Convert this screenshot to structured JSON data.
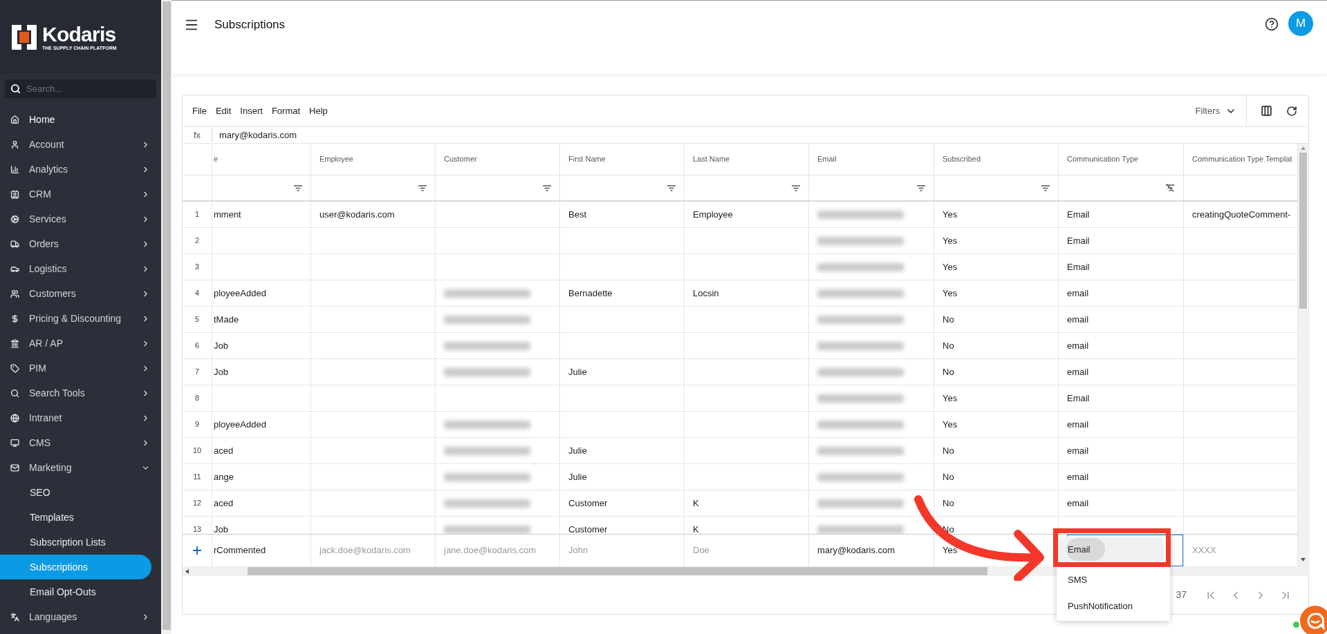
{
  "sidebar": {
    "logo": {
      "name": "Kodaris",
      "tagline": "THE SUPPLY CHAIN PLATFORM"
    },
    "search_placeholder": "Search...",
    "items": [
      {
        "label": "Home",
        "expandable": false
      },
      {
        "label": "Account",
        "expandable": true,
        "expanded": false
      },
      {
        "label": "Analytics",
        "expandable": true,
        "expanded": false
      },
      {
        "label": "CRM",
        "expandable": true,
        "expanded": false
      },
      {
        "label": "Services",
        "expandable": true,
        "expanded": false
      },
      {
        "label": "Orders",
        "expandable": true,
        "expanded": false
      },
      {
        "label": "Logistics",
        "expandable": true,
        "expanded": false
      },
      {
        "label": "Customers",
        "expandable": true,
        "expanded": false
      },
      {
        "label": "Pricing & Discounting",
        "expandable": true,
        "expanded": false
      },
      {
        "label": "AR / AP",
        "expandable": true,
        "expanded": false
      },
      {
        "label": "PIM",
        "expandable": true,
        "expanded": false
      },
      {
        "label": "Search Tools",
        "expandable": true,
        "expanded": false
      },
      {
        "label": "Intranet",
        "expandable": true,
        "expanded": false
      },
      {
        "label": "CMS",
        "expandable": true,
        "expanded": false
      },
      {
        "label": "Marketing",
        "expandable": true,
        "expanded": true,
        "children": [
          {
            "label": "SEO",
            "selected": false
          },
          {
            "label": "Templates",
            "selected": false
          },
          {
            "label": "Subscription Lists",
            "selected": false
          },
          {
            "label": "Subscriptions",
            "selected": true
          },
          {
            "label": "Email Opt-Outs",
            "selected": false
          }
        ]
      },
      {
        "label": "Languages",
        "expandable": true,
        "expanded": false
      }
    ]
  },
  "header": {
    "title": "Subscriptions",
    "avatar": "M"
  },
  "toolbar": {
    "menus": [
      "File",
      "Edit",
      "Insert",
      "Format",
      "Help"
    ],
    "filters": "Filters"
  },
  "formula_bar": {
    "label": "fx",
    "value": "mary@kodaris.com"
  },
  "table": {
    "columns": [
      {
        "label": "e",
        "filterable": true,
        "filter_active": false
      },
      {
        "label": "Employee",
        "filterable": true,
        "filter_active": false
      },
      {
        "label": "Customer",
        "filterable": true,
        "filter_active": false
      },
      {
        "label": "First Name",
        "filterable": true,
        "filter_active": false
      },
      {
        "label": "Last Name",
        "filterable": true,
        "filter_active": false
      },
      {
        "label": "Email",
        "filterable": true,
        "filter_active": false
      },
      {
        "label": "Subscribed",
        "filterable": true,
        "filter_active": false
      },
      {
        "label": "Communication Type",
        "filterable": true,
        "filter_active": true
      },
      {
        "label": "Communication Type Templat",
        "filterable": false
      }
    ],
    "rows": [
      {
        "number": "1",
        "cells": [
          "mment",
          "user@kodaris.com",
          null,
          "Best",
          "Employee",
          {
            "redacted": true
          },
          "Yes",
          "Email",
          "creatingQuoteComment-"
        ]
      },
      {
        "number": "2",
        "cells": [
          null,
          null,
          null,
          null,
          null,
          {
            "redacted": true
          },
          "Yes",
          "Email",
          null
        ]
      },
      {
        "number": "3",
        "cells": [
          null,
          null,
          null,
          null,
          null,
          {
            "redacted": true
          },
          "Yes",
          "Email",
          null
        ]
      },
      {
        "number": "4",
        "cells": [
          "ployeeAdded",
          null,
          {
            "redacted": true
          },
          "Bernadette",
          "Locsin",
          {
            "redacted": true
          },
          "Yes",
          "email",
          null
        ]
      },
      {
        "number": "5",
        "cells": [
          "tMade",
          null,
          {
            "redacted": true
          },
          null,
          null,
          {
            "redacted": true
          },
          "No",
          "email",
          null
        ]
      },
      {
        "number": "6",
        "cells": [
          "Job",
          null,
          {
            "redacted": true
          },
          null,
          null,
          {
            "redacted": true
          },
          "No",
          "email",
          null
        ]
      },
      {
        "number": "7",
        "cells": [
          "Job",
          null,
          {
            "redacted": true
          },
          "Julie",
          null,
          {
            "redacted": true
          },
          "No",
          "email",
          null
        ]
      },
      {
        "number": "8",
        "cells": [
          null,
          null,
          null,
          null,
          null,
          {
            "redacted": true
          },
          "Yes",
          "Email",
          null
        ]
      },
      {
        "number": "9",
        "cells": [
          "ployeeAdded",
          null,
          {
            "redacted": true
          },
          null,
          null,
          {
            "redacted": true
          },
          "Yes",
          "email",
          null
        ]
      },
      {
        "number": "10",
        "cells": [
          "aced",
          null,
          {
            "redacted": true
          },
          "Julie",
          null,
          {
            "redacted": true
          },
          "No",
          "email",
          null
        ]
      },
      {
        "number": "11",
        "cells": [
          "ange",
          null,
          {
            "redacted": true
          },
          "Julie",
          null,
          {
            "redacted": true
          },
          "No",
          "email",
          null
        ]
      },
      {
        "number": "12",
        "cells": [
          "aced",
          null,
          {
            "redacted": true
          },
          "Customer",
          "K",
          {
            "redacted": true
          },
          "No",
          "email",
          null
        ]
      },
      {
        "number": "13",
        "cells": [
          "Job",
          null,
          {
            "redacted": true
          },
          "Customer",
          "K",
          {
            "redacted": true
          },
          "No",
          null,
          null
        ]
      }
    ],
    "new_row": {
      "cells": [
        {
          "value": "rCommented"
        },
        {
          "placeholder": "jack.doe@kodaris.com"
        },
        {
          "placeholder": "jane.doe@kodaris.com"
        },
        {
          "placeholder": "John"
        },
        {
          "placeholder": "Doe"
        },
        {
          "value": "mary@kodaris.com"
        },
        {
          "value": "Yes"
        },
        {
          "kind": "dropdown"
        },
        {
          "placeholder": "XXXX"
        }
      ],
      "dropdown_options": [
        {
          "label": "Email",
          "selected": true
        },
        {
          "label": "SMS",
          "selected": false
        },
        {
          "label": "PushNotification",
          "selected": false
        }
      ]
    }
  },
  "pagination": {
    "text": "37"
  }
}
